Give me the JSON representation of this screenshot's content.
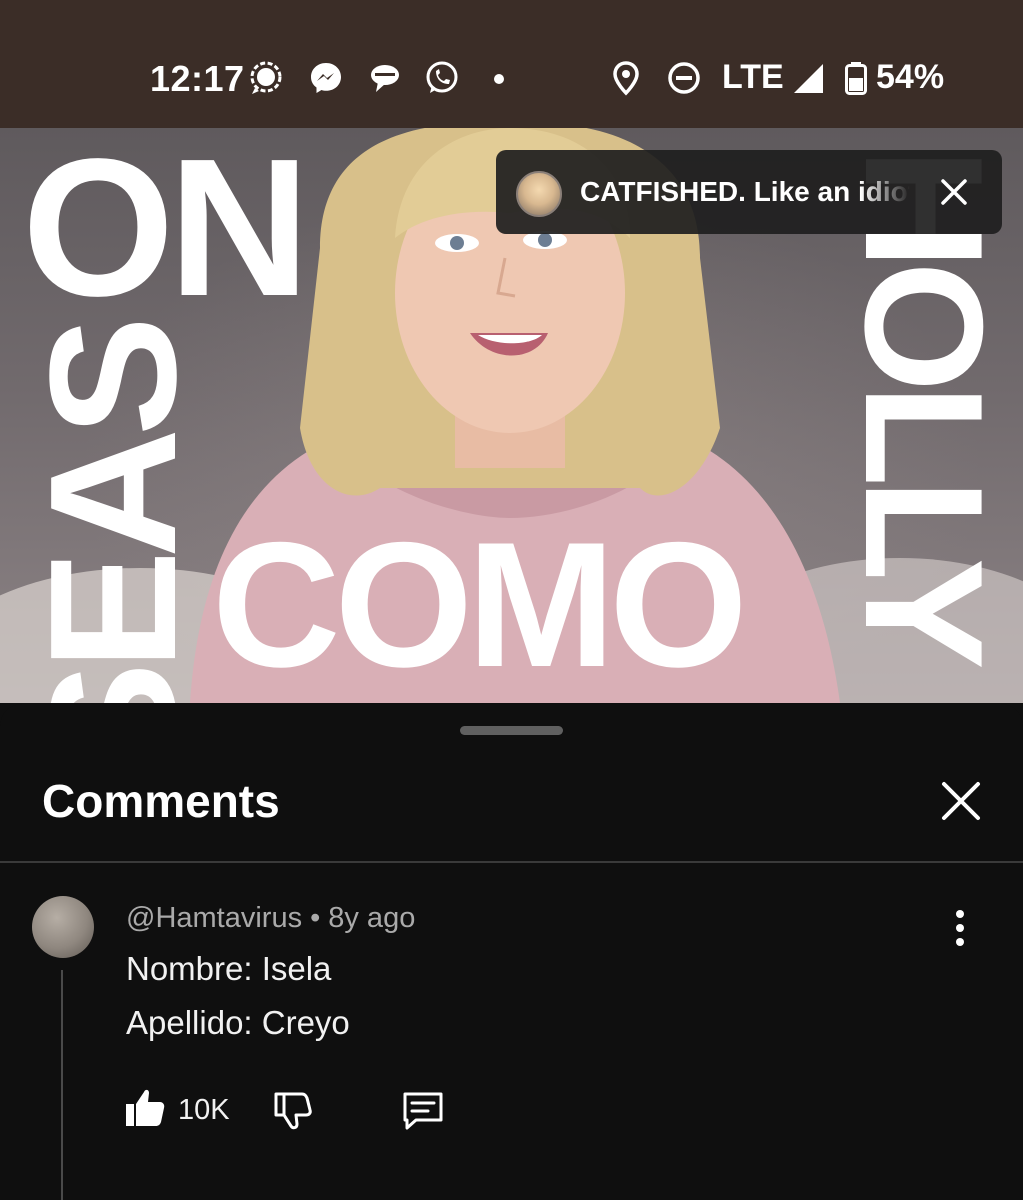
{
  "status_bar": {
    "time": "12:17",
    "network": "LTE",
    "battery": "54%",
    "notification_icons": [
      "signal-icon",
      "messenger-icon",
      "chat-icon",
      "whatsapp-icon"
    ],
    "indicator_icons": [
      "location-icon",
      "do-not-disturb-icon",
      "cell-signal-icon",
      "battery-icon"
    ]
  },
  "video": {
    "thumbnail_words": [
      "ON",
      "SEAS",
      "COMO",
      "HOLLY"
    ],
    "overlay_title": "CATFISHED. Like an idiot"
  },
  "comments_panel": {
    "title": "Comments",
    "comment": {
      "author": "@Hamtavirus",
      "separator": "•",
      "age": "8y ago",
      "lines": [
        "Nombre: Isela",
        "Apellido: Creyo"
      ],
      "like_count": "10K"
    }
  },
  "colors": {
    "status_bar_bg": "#3b2d27",
    "sheet_bg": "#0f0f0f",
    "meta_text": "#aaaaaa"
  }
}
